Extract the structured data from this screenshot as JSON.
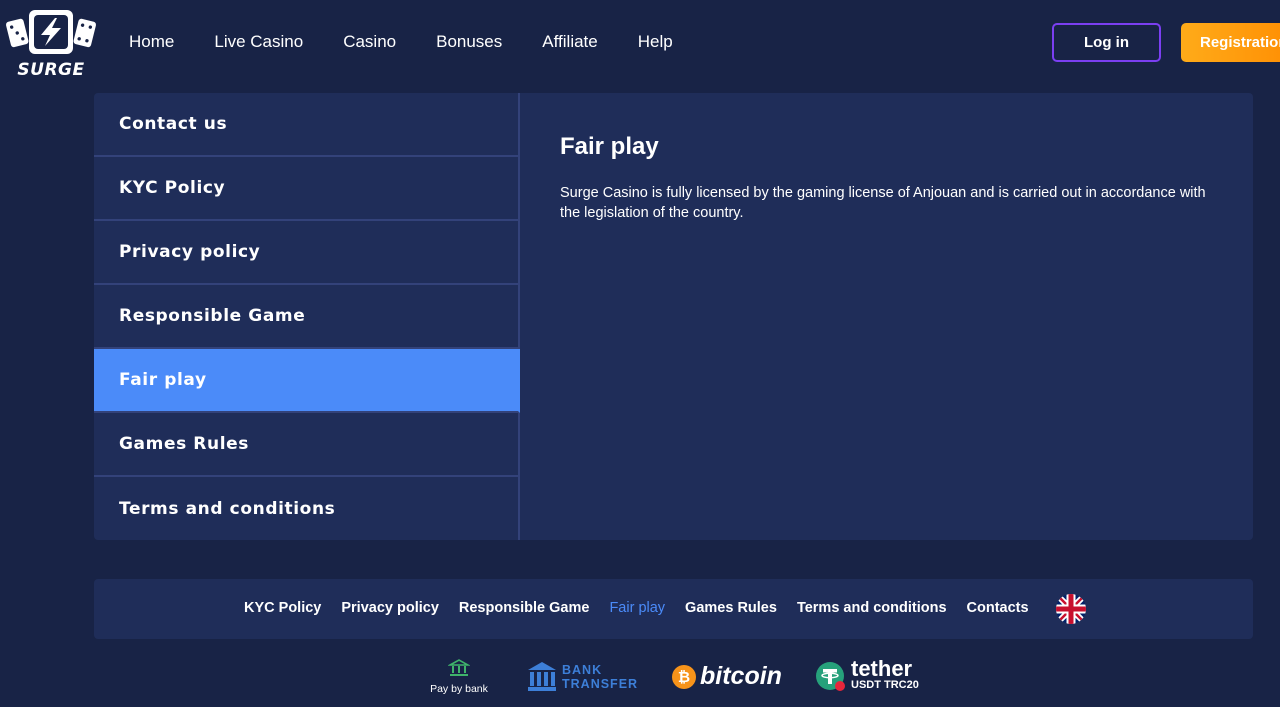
{
  "header": {
    "logo_text": "SURGE",
    "nav": [
      "Home",
      "Live Casino",
      "Casino",
      "Bonuses",
      "Affiliate",
      "Help"
    ],
    "login_label": "Log in",
    "register_label": "Registration"
  },
  "sidebar": {
    "items": [
      {
        "label": "Contact us"
      },
      {
        "label": "KYC Policy"
      },
      {
        "label": "Privacy policy"
      },
      {
        "label": "Responsible Game"
      },
      {
        "label": "Fair play",
        "active": true
      },
      {
        "label": "Games Rules"
      },
      {
        "label": "Terms and conditions"
      }
    ]
  },
  "content": {
    "title": "Fair play",
    "body": "Surge Casino is fully licensed by the gaming license of Anjouan and is carried out in accordance with the legislation of the country."
  },
  "footer": {
    "links": [
      "KYC Policy",
      "Privacy policy",
      "Responsible Game",
      "Fair play",
      "Games Rules",
      "Terms and conditions",
      "Contacts"
    ],
    "current": "Fair play",
    "language_icon": "uk-flag-icon"
  },
  "payments": {
    "pay_by_bank": "Pay by bank",
    "bank_transfer_line1": "BANK",
    "bank_transfer_line2": "TRANSFER",
    "bitcoin": "bitcoin",
    "tether": "tether",
    "tether_sub": "USDT TRC20"
  },
  "colors": {
    "background": "#182346",
    "panel": "#1f2d59",
    "accent_blue": "#4b8bf9",
    "login_border": "#7b3ff2",
    "register_orange": "#ff9f0f",
    "bitcoin_orange": "#f7931a",
    "tether_green": "#26a17b"
  }
}
